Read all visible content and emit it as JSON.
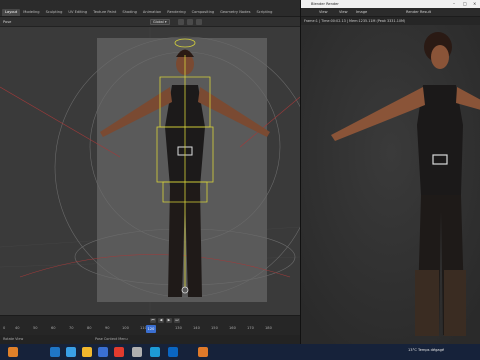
{
  "left_window": {
    "workspace_tabs": [
      "Layout",
      "Modeling",
      "Sculpting",
      "UV Editing",
      "Texture Paint",
      "Shading",
      "Animation",
      "Rendering",
      "Compositing",
      "Geometry Nodes",
      "Scripting"
    ],
    "active_tab": "Layout",
    "mode_label": "Pose",
    "transform_orientation": "Global",
    "timeline": {
      "ticks": [
        "0",
        "40",
        "50",
        "60",
        "70",
        "80",
        "90",
        "100",
        "110",
        "120",
        "130",
        "140",
        "150",
        "160",
        "170",
        "180"
      ],
      "current_frame": "120"
    },
    "status": {
      "left": "Rotate View",
      "center": "Pose Context Menu"
    }
  },
  "render_window": {
    "title": "Blender Render",
    "menu": [
      "View",
      "View",
      "Image",
      "Render Result"
    ],
    "info": "Frame:1 | Time:00:02.13 | Mem:1235.11M (Peak 3331.10M)"
  },
  "taskbar": {
    "weather": "13°C  Temps dégagé",
    "colors": {
      "bg": "#16223a",
      "icons": [
        "#e0812a",
        "#1f76c6",
        "#3aa0e6",
        "#f1b82d",
        "#e23b2e",
        "#3a6fd1",
        "#b0b0b0",
        "#1d9bd7",
        "#0a66c2",
        "#e07a2a"
      ]
    }
  }
}
